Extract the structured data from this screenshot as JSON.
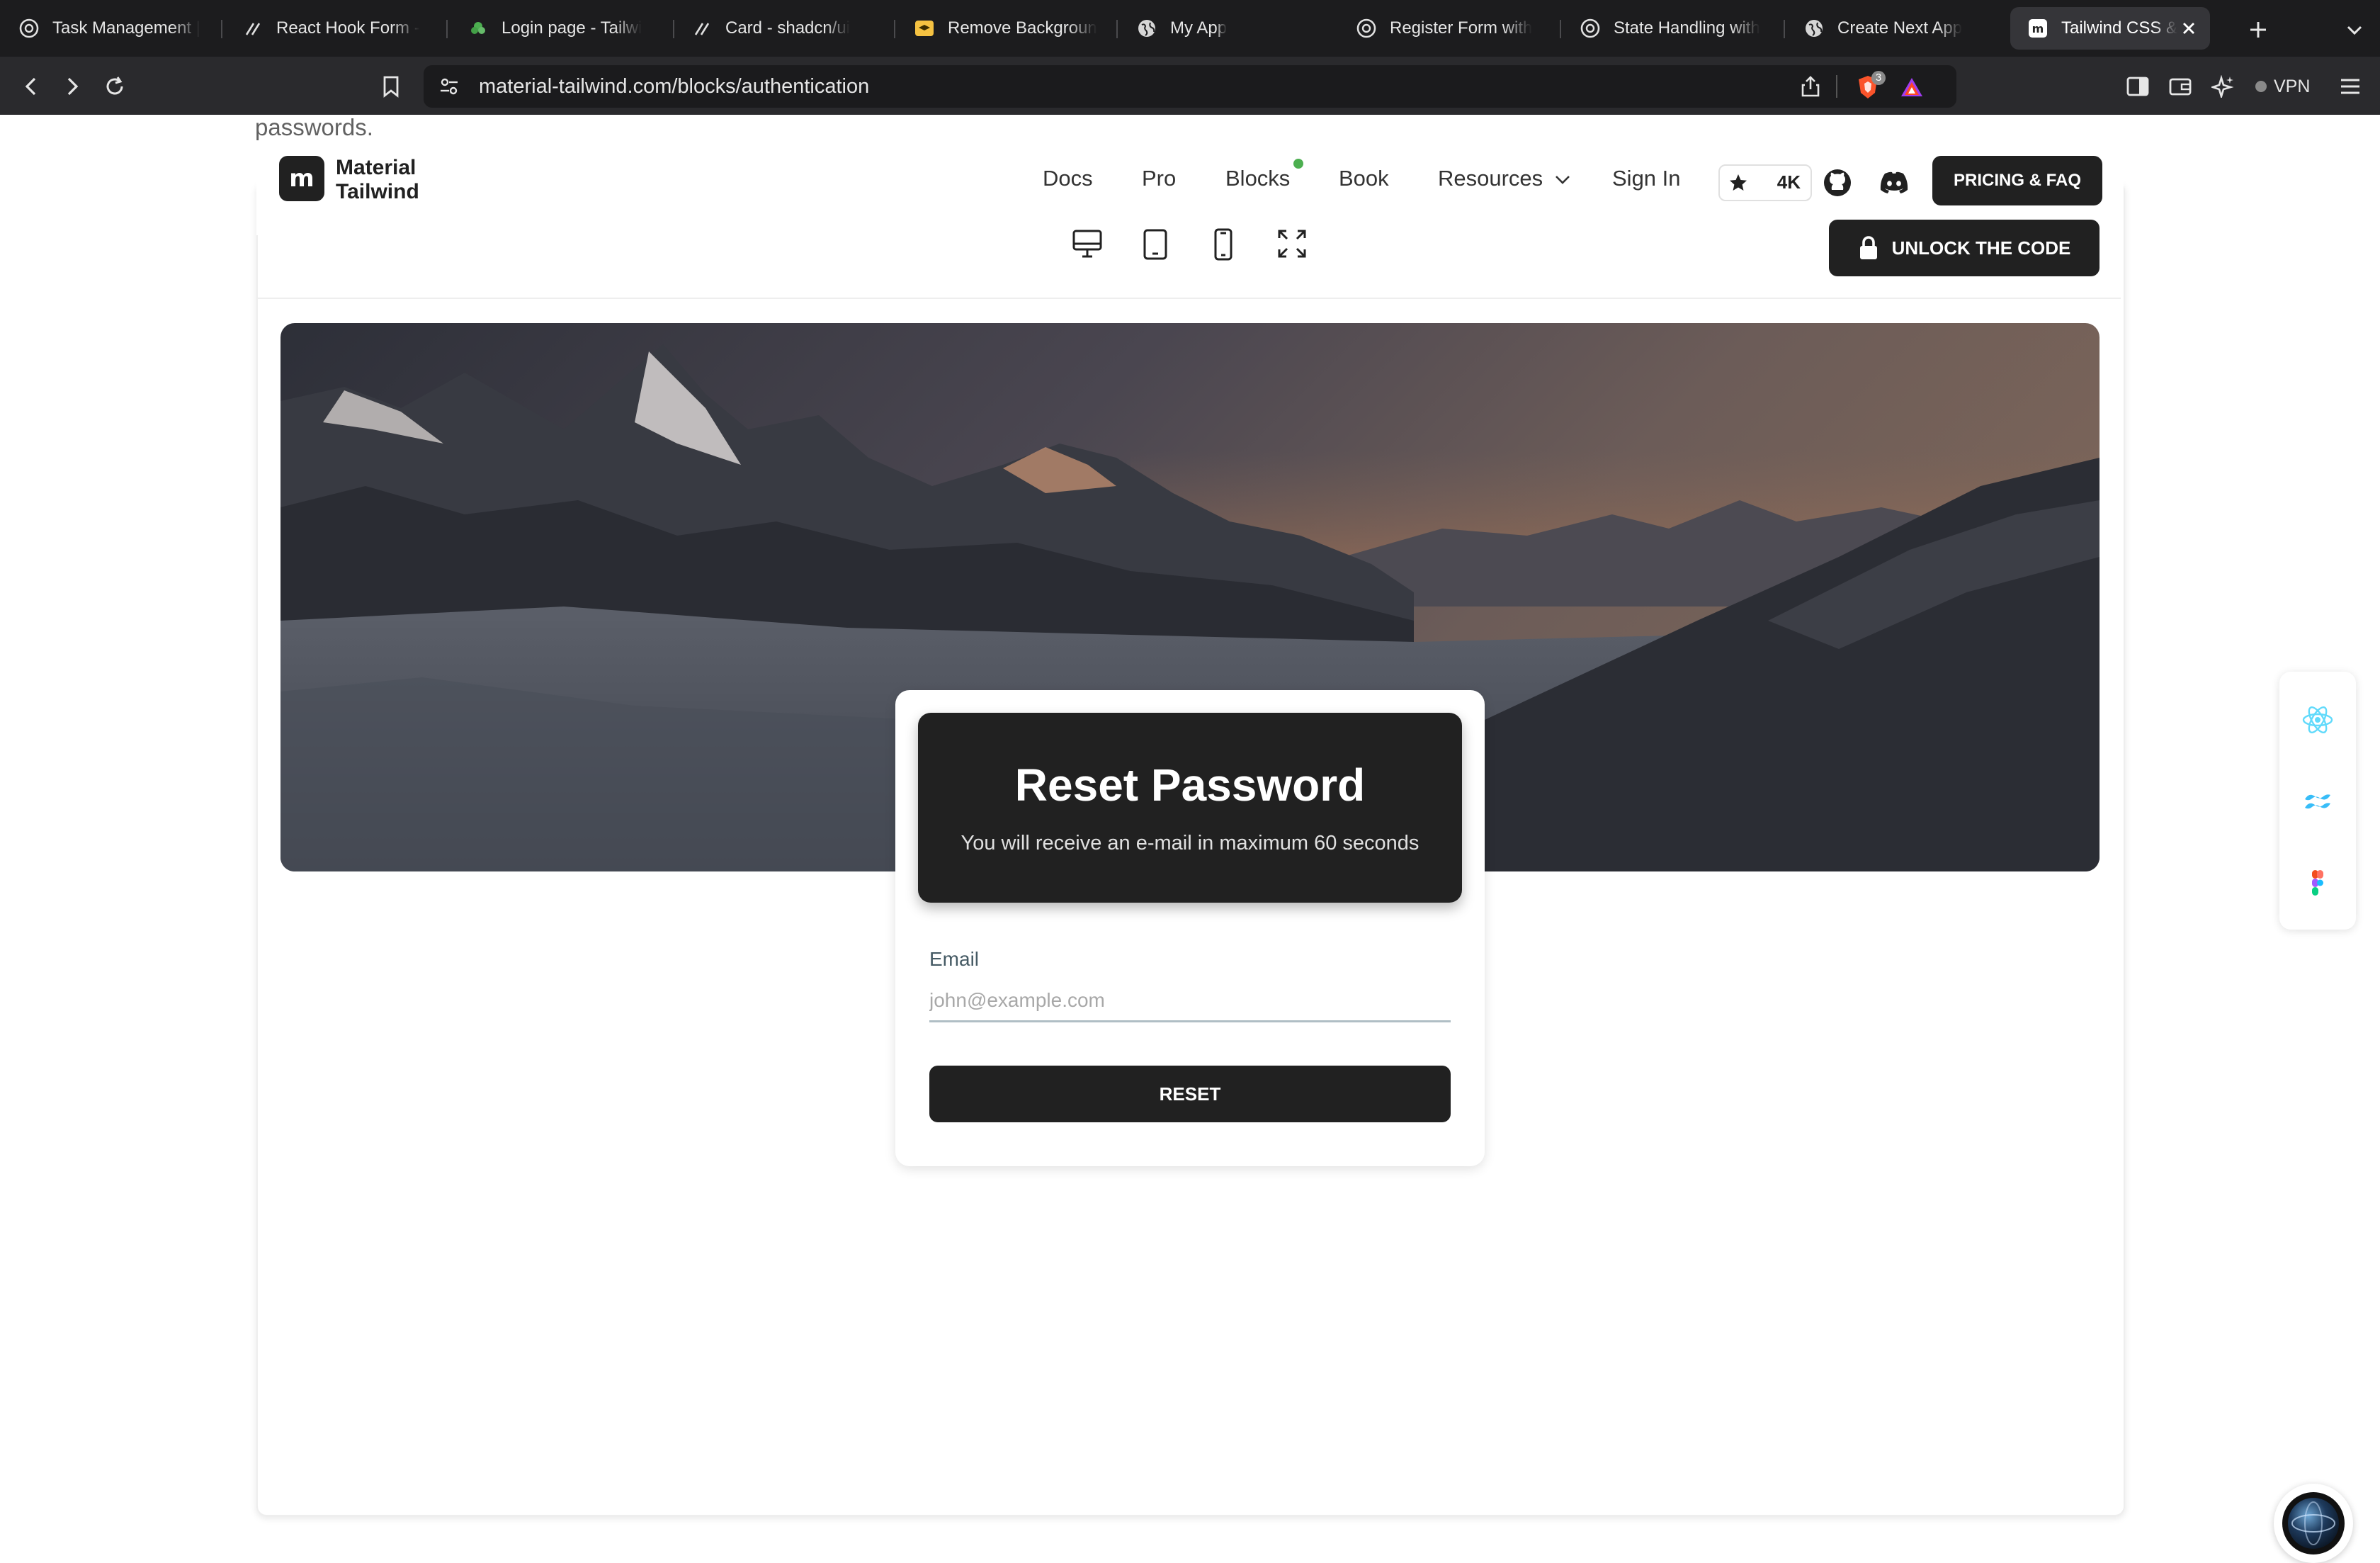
{
  "browser": {
    "tabs": [
      {
        "title": "Task Management |",
        "icon": "openai-icon"
      },
      {
        "title": "React Hook Form -",
        "icon": "shadcn-icon"
      },
      {
        "title": "Login page - Tailwi",
        "icon": "tailwind-leaf-icon"
      },
      {
        "title": "Card - shadcn/ui",
        "icon": "shadcn-icon"
      },
      {
        "title": "Remove Backgroun",
        "icon": "removebg-icon"
      },
      {
        "title": "My App",
        "icon": "globe-icon"
      },
      {
        "title": "Register Form with",
        "icon": "openai-icon"
      },
      {
        "title": "State Handling with",
        "icon": "openai-icon"
      },
      {
        "title": "Create Next App",
        "icon": "globe-icon"
      },
      {
        "title": "Tailwind CSS &",
        "icon": "material-tailwind-icon",
        "active": true
      }
    ],
    "url": "material-tailwind.com/blocks/authentication",
    "shields_count": "3",
    "vpn_label": "VPN"
  },
  "page": {
    "intro_text": "passwords.",
    "logo": {
      "mark": "m",
      "line1": "Material",
      "line2": "Tailwind"
    },
    "nav": {
      "docs": "Docs",
      "pro": "Pro",
      "blocks": "Blocks",
      "book": "Book",
      "resources": "Resources",
      "sign_in": "Sign In"
    },
    "github_stars": "4K",
    "pricing_button": "PRICING & FAQ",
    "unlock_button": "UNLOCK THE CODE",
    "reset_card": {
      "title": "Reset Password",
      "subtitle": "You will receive an e-mail in maximum 60 seconds",
      "email_label": "Email",
      "email_placeholder": "john@example.com",
      "email_value": "",
      "reset_button": "RESET"
    }
  },
  "colors": {
    "dark": "#212121",
    "accent_dot": "#4caf50",
    "react_blue": "#61dafb",
    "tailwind_cyan": "#38bdf8"
  }
}
